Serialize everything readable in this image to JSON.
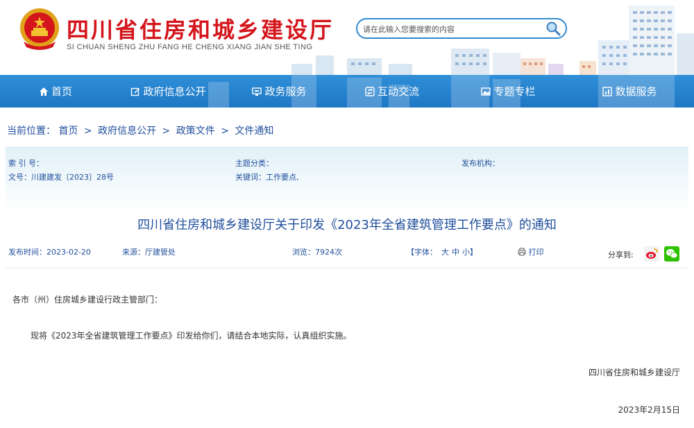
{
  "header": {
    "title": "四川省住房和城乡建设厅",
    "pinyin": "SI CHUAN SHENG ZHU FANG HE CHENG XIANG JIAN SHE TING",
    "search_placeholder": "请在此输入您要搜索的内容",
    "emblem_icon": "national-emblem-icon",
    "search_icon": "magnifier-icon"
  },
  "nav": {
    "items": [
      {
        "label": "首页",
        "icon": "home-icon"
      },
      {
        "label": "政府信息公开",
        "icon": "edit-icon"
      },
      {
        "label": "政务服务",
        "icon": "monitor-icon"
      },
      {
        "label": "互动交流",
        "icon": "exchange-icon"
      },
      {
        "label": "专题专栏",
        "icon": "image-icon"
      },
      {
        "label": "数据服务",
        "icon": "chart-icon"
      }
    ]
  },
  "breadcrumb": {
    "label": "当前位置：",
    "items": [
      "首页",
      "政府信息公开",
      "政策文件",
      "文件通知"
    ],
    "separator": ">"
  },
  "meta": {
    "index_no": "索 引 号：",
    "topic": "主题分类：",
    "publisher": "发布机构：",
    "doc_no": "文号：川建建发〔2023〕28号",
    "keywords": "关键词：工作要点,"
  },
  "article": {
    "title": "四川省住房和城乡建设厅关于印发《2023年全省建筑管理工作要点》的通知",
    "publish_time": "发布时间：2023-02-20",
    "source": "来源：厅建管处",
    "views": "浏览：7924次",
    "font_label": "【字体：",
    "font_large": "大",
    "font_medium": "中",
    "font_small": "小",
    "font_end": "】",
    "print_label": "打印",
    "share_label": "分享到:",
    "share_icons": [
      "weibo-icon",
      "wechat-icon"
    ],
    "salutation": "各市（州）住房城乡建设行政主管部门：",
    "body": "现将《2023年全省建筑管理工作要点》印发给你们，请结合本地实际，认真组织实施。",
    "signature": "四川省住房和城乡建设厅",
    "date": "2023年2月15日"
  },
  "colors": {
    "brand_red": "#d4151c",
    "nav_blue": "#1f77c4",
    "link_blue": "#1f4e9c"
  }
}
